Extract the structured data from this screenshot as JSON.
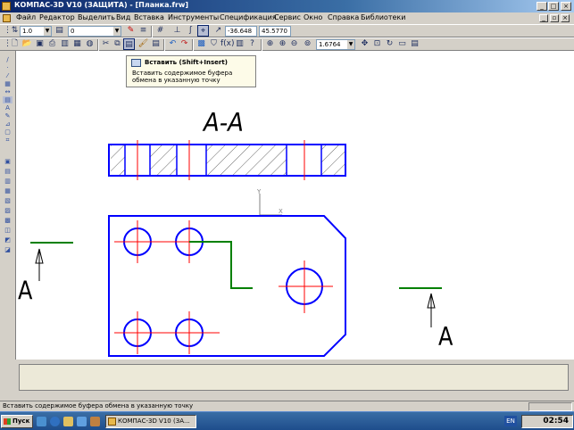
{
  "window": {
    "title": "КОМПАС-3D V10 (ЗАЩИТА) - [Планка.frw]"
  },
  "menu": [
    "Файл",
    "Редактор",
    "Выделить",
    "Вид",
    "Вставка",
    "Инструменты",
    "Спецификация",
    "Сервис",
    "Окно",
    "Справка",
    "Библиотеки"
  ],
  "toolbar": {
    "scale_value": "1.0",
    "layer_value": "0",
    "coord_x": "-36.648",
    "coord_y": "45.5770",
    "zoom_value": "1.6764"
  },
  "tooltip": {
    "title": "Вставить (Shift+Insert)",
    "description": "Вставить содержимое буфера обмена в указанную точку"
  },
  "drawing": {
    "section_title": "А-А",
    "label_left": "А",
    "label_right": "А",
    "axis_y": "Y",
    "axis_x": "X"
  },
  "statusbar": {
    "text": "Вставить содержимое буфера обмена в указанную точку"
  },
  "taskbar": {
    "start_label": "Пуск",
    "task_label": "КОМПАС-3D V10 (ЗА...",
    "lang": "EN",
    "clock": "02:54"
  },
  "colors": {
    "contour": "#0000ff",
    "centerline": "#ff0000",
    "section_line": "#008000",
    "title_bar": "#0a246a"
  }
}
